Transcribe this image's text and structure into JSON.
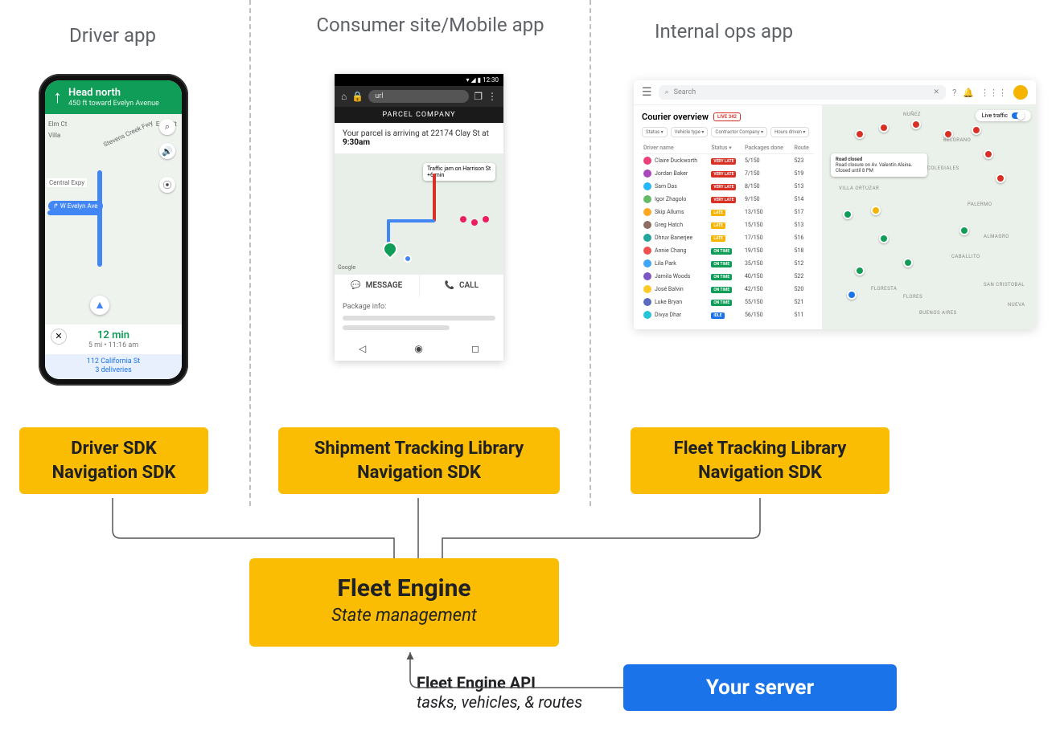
{
  "columns": {
    "driver": {
      "header": "Driver app"
    },
    "consumer": {
      "header": "Consumer site/Mobile app"
    },
    "ops": {
      "header": "Internal ops app"
    }
  },
  "sdk": {
    "driver": {
      "line1": "Driver SDK",
      "line2": "Navigation SDK"
    },
    "consumer": {
      "line1": "Shipment Tracking Library",
      "line2": "Navigation SDK"
    },
    "ops": {
      "line1": "Fleet Tracking Library",
      "line2": "Navigation SDK"
    }
  },
  "fleet_engine": {
    "title": "Fleet Engine",
    "subtitle": "State management"
  },
  "server": {
    "label": "Your server"
  },
  "api": {
    "line1": "Fleet Engine API",
    "line2": "tasks, vehicles, & routes"
  },
  "driver_app": {
    "distance": "450 ft",
    "direction": "Head north",
    "toward": "toward Evelyn Avenue",
    "chip": "↱ W Evelyn Ave",
    "labels": {
      "central": "Central Expy",
      "elm": "Elm Ct",
      "villa": "Villa",
      "creek": "Stevens Creek Fwy",
      "easy": "Easy St"
    },
    "eta": "12 min",
    "eta_sub": "5 mi • 11:16 am",
    "dest1": "112 California St",
    "dest2": "3 deliveries"
  },
  "consumer_app": {
    "status_time": "▾ ◢ ▮ 12:30",
    "url_placeholder": "url",
    "brand": "PARCEL COMPANY",
    "msg_pre": "Your parcel is arriving at 22174 Clay St at",
    "msg_time": "9:30am",
    "tooltip": "Traffic jam on Harrison St +6 min",
    "action_msg": "MESSAGE",
    "action_call": "CALL",
    "pkg_title": "Package info:",
    "google": "Google"
  },
  "ops_app": {
    "search_placeholder": "Search",
    "title": "Courier overview",
    "live": "LIVE 342",
    "filters": [
      "Status ▾",
      "Vehicle type ▾",
      "Contractor Company ▾",
      "Hours driven ▾"
    ],
    "cols": [
      "Driver name",
      "Status ▾",
      "Packages done",
      "Route"
    ],
    "rows": [
      {
        "name": "Claire Duckworth",
        "status": "VERY LATE",
        "class": "vl",
        "pkg": "5/150",
        "route": "523",
        "av": "#ec407a"
      },
      {
        "name": "Jordan Baker",
        "status": "VERY LATE",
        "class": "vl",
        "pkg": "7/150",
        "route": "519",
        "av": "#ab47bc"
      },
      {
        "name": "Sam Das",
        "status": "VERY LATE",
        "class": "vl",
        "pkg": "8/150",
        "route": "513",
        "av": "#29b6f6"
      },
      {
        "name": "Igor Zhagolo",
        "status": "VERY LATE",
        "class": "vl",
        "pkg": "9/150",
        "route": "514",
        "av": "#66bb6a"
      },
      {
        "name": "Skip Allums",
        "status": "LATE",
        "class": "lt",
        "pkg": "13/150",
        "route": "517",
        "av": "#ffa726"
      },
      {
        "name": "Greg Hatch",
        "status": "LATE",
        "class": "lt",
        "pkg": "15/150",
        "route": "513",
        "av": "#8d6e63"
      },
      {
        "name": "Dhruv Banerjee",
        "status": "LATE",
        "class": "lt",
        "pkg": "17/150",
        "route": "516",
        "av": "#26a69a"
      },
      {
        "name": "Annie Chang",
        "status": "ON TIME",
        "class": "ot",
        "pkg": "19/150",
        "route": "518",
        "av": "#ef5350"
      },
      {
        "name": "Lila Park",
        "status": "ON TIME",
        "class": "ot",
        "pkg": "35/150",
        "route": "512",
        "av": "#42a5f5"
      },
      {
        "name": "Jamila Woods",
        "status": "ON TIME",
        "class": "ot",
        "pkg": "40/150",
        "route": "522",
        "av": "#7e57c2"
      },
      {
        "name": "José Balvin",
        "status": "ON TIME",
        "class": "ot",
        "pkg": "42/150",
        "route": "520",
        "av": "#ffca28"
      },
      {
        "name": "Luke Bryan",
        "status": "ON TIME",
        "class": "ot",
        "pkg": "55/150",
        "route": "521",
        "av": "#5c6bc0"
      },
      {
        "name": "Divya Dhar",
        "status": "IDLE",
        "class": "id",
        "pkg": "56/150",
        "route": "511",
        "av": "#26c6da"
      }
    ],
    "map": {
      "traffic_label": "Live traffic",
      "tooltip_title": "Road closed",
      "tooltip_line": "Road closure on Av. Valentín Alsina. Closed until 8 PM",
      "labels": [
        "NUÑEZ",
        "BELGRANO",
        "COLEGIALES",
        "VILLA ORTUZAR",
        "PALERMO",
        "ALMAGRO",
        "CABALLITO",
        "FLORESTA",
        "FLORES",
        "SAN CRISTOBAL",
        "NUEVA",
        "BUENOS AIRES"
      ]
    }
  }
}
